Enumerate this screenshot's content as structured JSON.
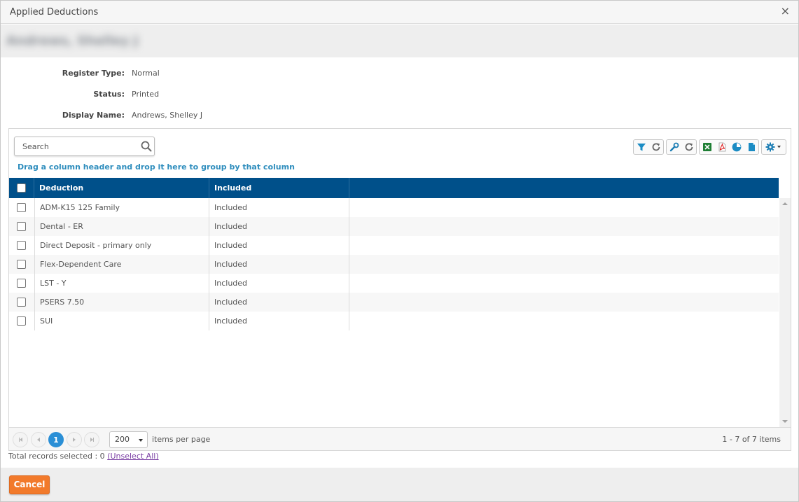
{
  "dialog": {
    "title": "Applied Deductions",
    "close_glyph": "×"
  },
  "banner": {
    "blurred_name": "Andrews, Shelley J"
  },
  "info": {
    "register_type_label": "Register Type:",
    "register_type_value": "Normal",
    "status_label": "Status:",
    "status_value": "Printed",
    "display_name_label": "Display Name:",
    "display_name_value": "Andrews, Shelley J"
  },
  "grid": {
    "search_placeholder": "Search",
    "group_hint": "Drag a column header and drop it here to group by that column",
    "toolbar_icons": [
      "filter-icon",
      "refresh-icon",
      "wrench-icon",
      "refresh-icon",
      "excel-icon",
      "pdf-icon",
      "chart-icon",
      "document-icon",
      "gear-icon"
    ],
    "columns": {
      "deduction": "Deduction",
      "included": "Included"
    },
    "rows": [
      {
        "deduction": "ADM-K15 125 Family",
        "included": "Included"
      },
      {
        "deduction": "Dental - ER",
        "included": "Included"
      },
      {
        "deduction": "Direct Deposit - primary only",
        "included": "Included"
      },
      {
        "deduction": "Flex-Dependent Care",
        "included": "Included"
      },
      {
        "deduction": "LST - Y",
        "included": "Included"
      },
      {
        "deduction": "PSERS 7.50",
        "included": "Included"
      },
      {
        "deduction": "SUI",
        "included": "Included"
      }
    ]
  },
  "pager": {
    "current_page": "1",
    "page_size": "200",
    "items_per_page_label": "items per page",
    "range_text": "1 - 7 of 7 items"
  },
  "selection": {
    "text": "Total records selected : 0 ",
    "unselect_label": "(Unselect All)"
  },
  "footer": {
    "cancel_label": "Cancel"
  },
  "colors": {
    "header_bg": "#00508a",
    "accent_link": "#2e8dbd",
    "cancel_bg": "#f27a2b",
    "active_page": "#2a8fd6"
  }
}
